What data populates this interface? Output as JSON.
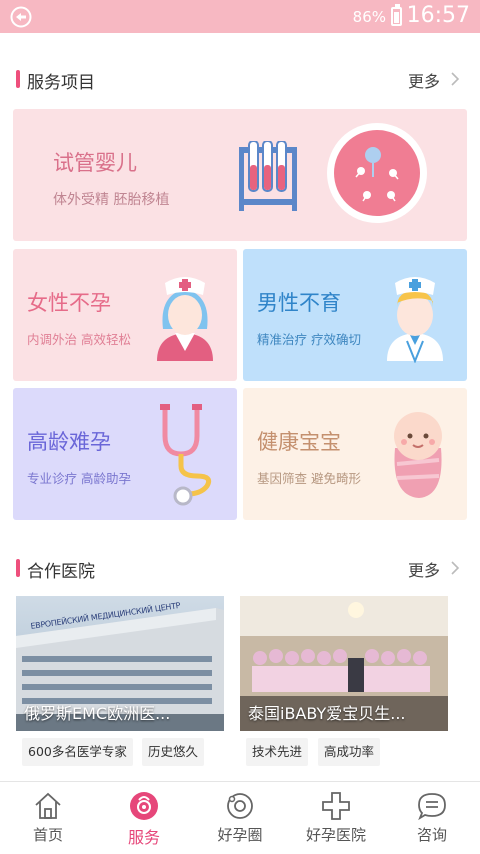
{
  "status_bar": {
    "battery": "86%",
    "time": "16:57"
  },
  "services": {
    "title": "服务项目",
    "more": "更多",
    "banner": {
      "title": "试管婴儿",
      "subtitle": "体外受精  胚胎移植"
    },
    "cards": [
      {
        "title": "女性不孕",
        "subtitle": "内调外治  高效轻松"
      },
      {
        "title": "男性不育",
        "subtitle": "精准治疗  疗效确切"
      },
      {
        "title": "高龄难孕",
        "subtitle": "专业诊疗  高龄助孕"
      },
      {
        "title": "健康宝宝",
        "subtitle": "基因筛查  避免畸形"
      }
    ]
  },
  "hospitals": {
    "title": "合作医院",
    "more": "更多",
    "items": [
      {
        "name": "俄罗斯EMC欧洲医...",
        "sign": "ЕВРОПЕЙСКИЙ МЕДИЦИНСКИЙ ЦЕНТР",
        "tags": [
          "600多名医学专家",
          "历史悠久"
        ]
      },
      {
        "name": "泰国iBABY爱宝贝生...",
        "tags": [
          "技术先进",
          "高成功率"
        ]
      }
    ]
  },
  "tabbar": {
    "active": "服务",
    "items": [
      {
        "label": "首页",
        "icon": "home-icon"
      },
      {
        "label": "服务",
        "icon": "baby-face-icon"
      },
      {
        "label": "好孕圈",
        "icon": "circle-community-icon"
      },
      {
        "label": "好孕医院",
        "icon": "medical-cross-icon"
      },
      {
        "label": "咨询",
        "icon": "chat-bubble-icon"
      }
    ]
  },
  "colors": {
    "accent": "#e6477a",
    "status_bar": "#f7b8c2",
    "blue_card": "#bfe0fb",
    "pink_card": "#fbe1e4",
    "lavender_card": "#dcdafb",
    "cream_card": "#fdf1e6"
  }
}
